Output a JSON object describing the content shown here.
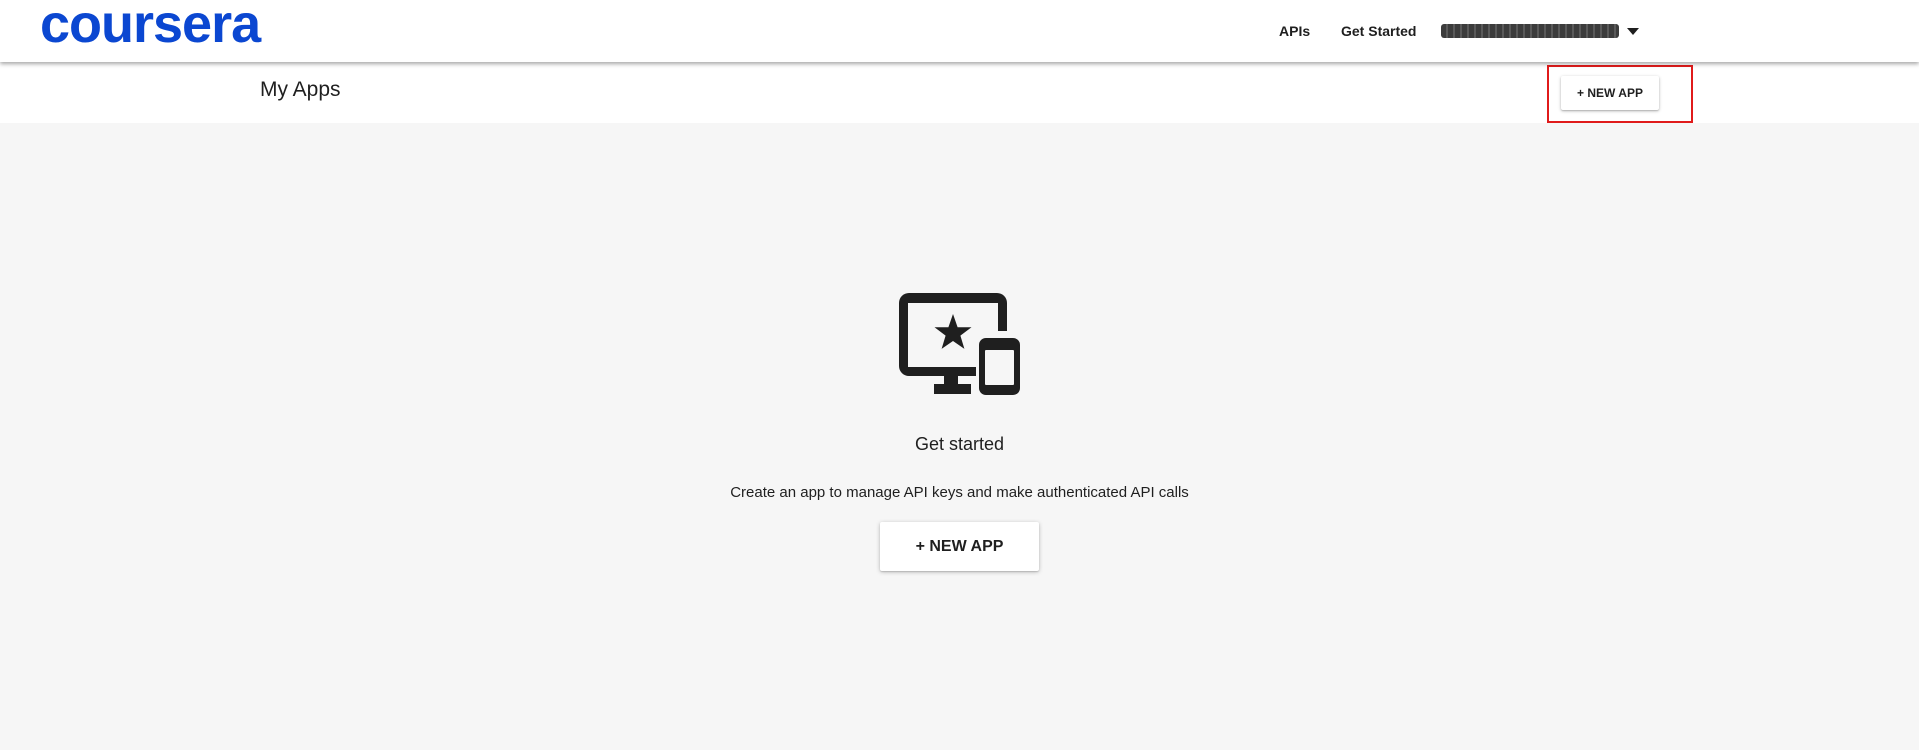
{
  "header": {
    "logo_text": "coursera",
    "brand_color": "#0b47d1",
    "nav": {
      "apis": "APIs",
      "get_started": "Get Started"
    },
    "user_name_redacted": "████████████████████"
  },
  "subheader": {
    "title": "My Apps",
    "new_app_label": "+ NEW APP",
    "highlight_color": "#e01b1b"
  },
  "empty_state": {
    "icon": "desktop-mobile-star-icon",
    "title": "Get started",
    "description": "Create an app to manage API keys and make authenticated API calls",
    "button_label": "+ NEW APP"
  }
}
